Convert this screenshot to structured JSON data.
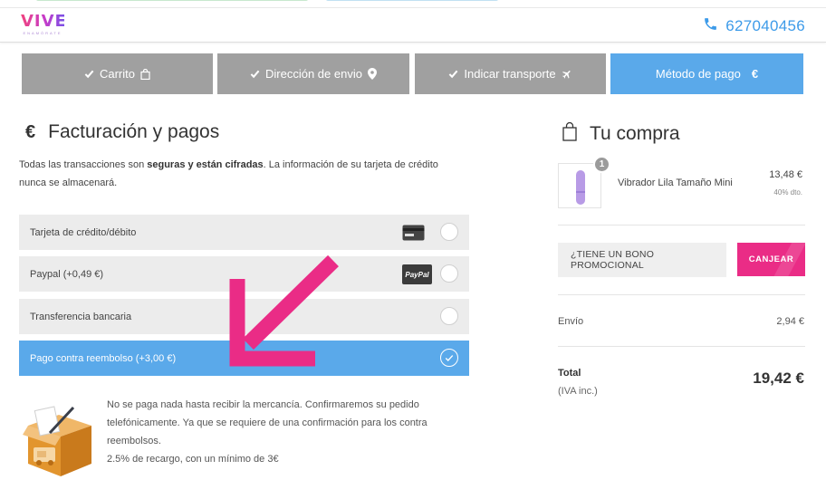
{
  "brand": {
    "logo_text": "VIVE",
    "logo_sub": "ENAMÓRATE",
    "accent": "#5aa9ea",
    "pink": "#ea2c86"
  },
  "header": {
    "phone": "627040456"
  },
  "steps": [
    {
      "label": "Carrito",
      "icon": "shopping-bag-icon",
      "state": "done"
    },
    {
      "label": "Dirección de envio",
      "icon": "map-marker-icon",
      "state": "done"
    },
    {
      "label": "Indicar transporte",
      "icon": "plane-icon",
      "state": "done"
    },
    {
      "label": "Método de pago",
      "icon": "euro-icon",
      "state": "active"
    }
  ],
  "billing": {
    "title": "Facturación y pagos",
    "intro_pre": "Todas las transacciones son ",
    "intro_bold": "seguras y están cifradas",
    "intro_post": ". La información de su tarjeta de crédito nunca se almacenará.",
    "options": [
      {
        "label": "Tarjeta de crédito/débito",
        "icon": "credit-card-icon",
        "selected": false
      },
      {
        "label": "Paypal (+0,49 €)",
        "icon": "paypal-icon",
        "icon_text": "PayPal",
        "selected": false
      },
      {
        "label": "Transferencia bancaria",
        "icon": "",
        "selected": false
      },
      {
        "label": "Pago contra reembolso (+3,00 €)",
        "icon": "",
        "selected": true
      }
    ],
    "cod_description": "No se paga nada hasta recibir la mercancía. Confirmaremos su pedido telefónicamente. Ya que se requiere de una confirmación para los contra reembolsos.",
    "cod_fee_note": "2.5% de recargo, con un mínimo de 3€"
  },
  "cart": {
    "title": "Tu compra",
    "item": {
      "name": "Vibrador Lila Tamaño Mini",
      "qty": "1",
      "price": "13,48 €",
      "discount": "40% dto."
    },
    "promo_placeholder": "¿TIENE UN BONO PROMOCIONAL",
    "promo_button": "CANJEAR",
    "shipping_label": "Envío",
    "shipping_value": "2,94 €",
    "total_label": "Total",
    "total_sub": "(IVA inc.)",
    "total_value": "19,42 €"
  }
}
